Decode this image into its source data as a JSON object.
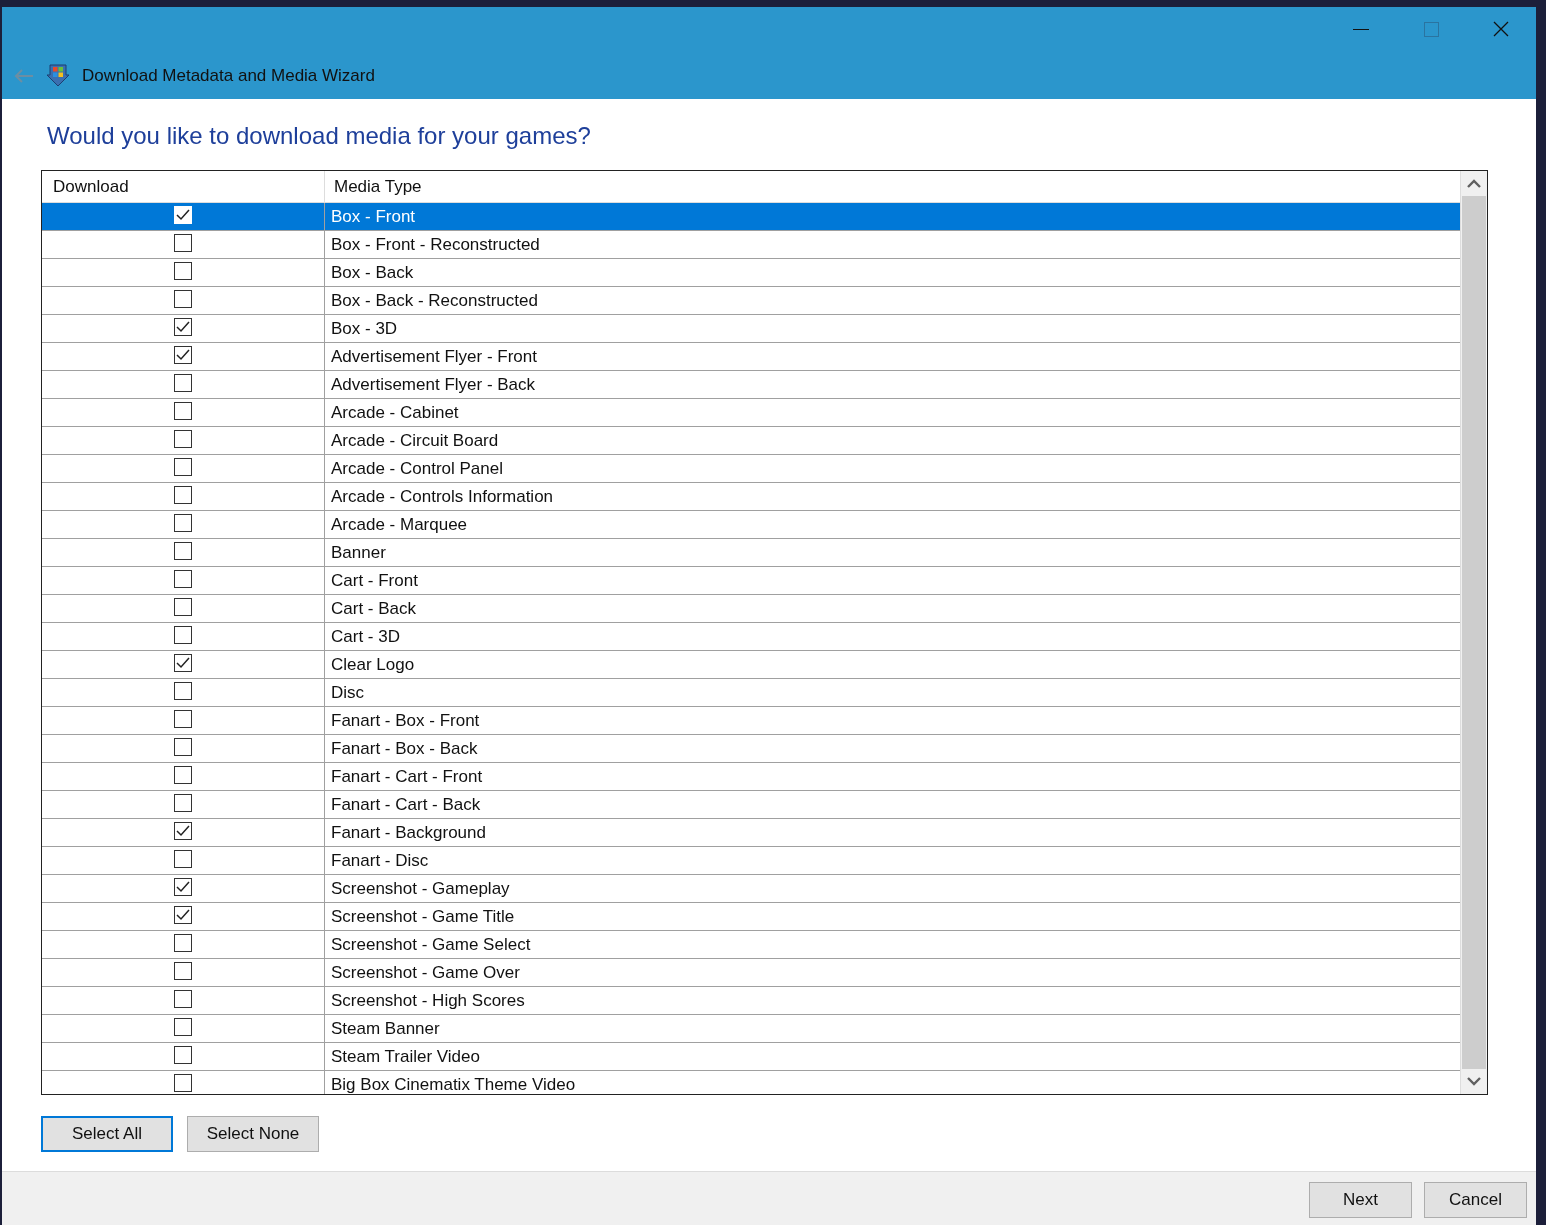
{
  "window": {
    "title": "Download Metadata and Media Wizard"
  },
  "heading": "Would you like to download media for your games?",
  "table": {
    "columns": [
      "Download",
      "Media Type"
    ],
    "rows": [
      {
        "media_type": "Box - Front",
        "checked": true,
        "selected": true
      },
      {
        "media_type": "Box - Front - Reconstructed",
        "checked": false,
        "selected": false
      },
      {
        "media_type": "Box - Back",
        "checked": false,
        "selected": false
      },
      {
        "media_type": "Box - Back - Reconstructed",
        "checked": false,
        "selected": false
      },
      {
        "media_type": "Box - 3D",
        "checked": true,
        "selected": false
      },
      {
        "media_type": "Advertisement Flyer - Front",
        "checked": true,
        "selected": false
      },
      {
        "media_type": "Advertisement Flyer - Back",
        "checked": false,
        "selected": false
      },
      {
        "media_type": "Arcade - Cabinet",
        "checked": false,
        "selected": false
      },
      {
        "media_type": "Arcade - Circuit Board",
        "checked": false,
        "selected": false
      },
      {
        "media_type": "Arcade - Control Panel",
        "checked": false,
        "selected": false
      },
      {
        "media_type": "Arcade - Controls Information",
        "checked": false,
        "selected": false
      },
      {
        "media_type": "Arcade - Marquee",
        "checked": false,
        "selected": false
      },
      {
        "media_type": "Banner",
        "checked": false,
        "selected": false
      },
      {
        "media_type": "Cart - Front",
        "checked": false,
        "selected": false
      },
      {
        "media_type": "Cart - Back",
        "checked": false,
        "selected": false
      },
      {
        "media_type": "Cart - 3D",
        "checked": false,
        "selected": false
      },
      {
        "media_type": "Clear Logo",
        "checked": true,
        "selected": false
      },
      {
        "media_type": "Disc",
        "checked": false,
        "selected": false
      },
      {
        "media_type": "Fanart - Box - Front",
        "checked": false,
        "selected": false
      },
      {
        "media_type": "Fanart - Box - Back",
        "checked": false,
        "selected": false
      },
      {
        "media_type": "Fanart - Cart - Front",
        "checked": false,
        "selected": false
      },
      {
        "media_type": "Fanart - Cart - Back",
        "checked": false,
        "selected": false
      },
      {
        "media_type": "Fanart - Background",
        "checked": true,
        "selected": false
      },
      {
        "media_type": "Fanart - Disc",
        "checked": false,
        "selected": false
      },
      {
        "media_type": "Screenshot - Gameplay",
        "checked": true,
        "selected": false
      },
      {
        "media_type": "Screenshot - Game Title",
        "checked": true,
        "selected": false
      },
      {
        "media_type": "Screenshot - Game Select",
        "checked": false,
        "selected": false
      },
      {
        "media_type": "Screenshot - Game Over",
        "checked": false,
        "selected": false
      },
      {
        "media_type": "Screenshot - High Scores",
        "checked": false,
        "selected": false
      },
      {
        "media_type": "Steam Banner",
        "checked": false,
        "selected": false
      },
      {
        "media_type": "Steam Trailer Video",
        "checked": false,
        "selected": false
      },
      {
        "media_type": "Big Box Cinematix Theme Video",
        "checked": false,
        "selected": false
      }
    ]
  },
  "selection_buttons": [
    "Select All",
    "Select None"
  ],
  "footer_buttons": [
    "Next",
    "Cancel"
  ]
}
